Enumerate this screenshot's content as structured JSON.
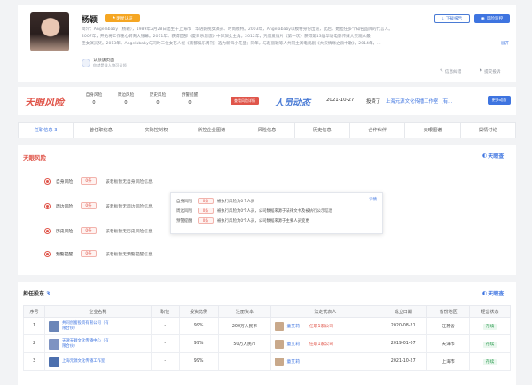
{
  "profile": {
    "name": "杨颖",
    "badge": "明星认证",
    "bio_line1": "简介：Angelababy（杨颖），1989年2月28日出生于上海市，华语影视女演员、时尚模特。2003年，Angelababy以模特身份出道，此后，她担任多个知名品牌的代言人。",
    "bio_line2": "2007年，开始将工作重心转向大银幕。2011年，获得首部《夏日乐悠悠》中饰演女主角。2012年，凭借爱情片《第一次》获得第13届华语电影传媒大奖观众最",
    "bio_line3": "佳女演员奖。2013年，Angelababy与同时三位女艺人被《南都娱乐周刊》选为新四小花旦；同年，与赵丽颖等人共同主演电视剧《大汉情缘之云中歌》，2014年，...",
    "bio_more": "展开",
    "claim_text": "认领该页面",
    "claim_sub": "你就是该人物可认领",
    "btn_download": "下载报告",
    "btn_monitor": "风险监控",
    "link_feedback": "信息纠错",
    "link_report": "提交投诉"
  },
  "risk_bar": {
    "brand": "天眼风险",
    "stats": [
      {
        "label": "自身风险",
        "value": "0"
      },
      {
        "label": "周边风险",
        "value": "0"
      },
      {
        "label": "历史风险",
        "value": "0"
      },
      {
        "label": "预警提醒",
        "value": "0"
      }
    ],
    "btn_risk": "查看风险详情",
    "news_brand": "人员动态",
    "news_date": "2021-10-27",
    "news_text": "投资了",
    "news_company": "上海元源文化传播工作室（有...",
    "btn_more": "更多动态"
  },
  "tabs": [
    {
      "label": "任职信息",
      "count": "3"
    },
    {
      "label": "曾任职信息",
      "count": ""
    },
    {
      "label": "实际控制权",
      "count": ""
    },
    {
      "label": "所控企业图谱",
      "count": ""
    },
    {
      "label": "风险信息",
      "count": ""
    },
    {
      "label": "历史信息",
      "count": ""
    },
    {
      "label": "合作伙伴",
      "count": ""
    },
    {
      "label": "天眼图谱",
      "count": ""
    },
    {
      "label": "舆情讨论",
      "count": ""
    }
  ],
  "risk_section": {
    "title": "天眼风险",
    "logo": "天眼查",
    "rows": [
      {
        "label": "自身风险",
        "count": "0条",
        "desc": "该老板暂无自身风险信息"
      },
      {
        "label": "周边风险",
        "count": "0条",
        "desc": "该老板暂无周边风险信息"
      },
      {
        "label": "历史风险",
        "count": "0条",
        "desc": "该老板暂无历史风险信息"
      },
      {
        "label": "预警提醒",
        "count": "0条",
        "desc": "该老板暂无预警提醒信息"
      }
    ],
    "popup": {
      "rows": [
        {
          "label": "自身风险",
          "tag": "0条",
          "text": "被执行风险为0个人员"
        },
        {
          "label": "周边风险",
          "tag": "0条",
          "text": "被执行风险为0个人员，公司数据来源于法律文书及被执行公示信息"
        },
        {
          "label": "预警提醒",
          "tag": "0条",
          "text": "被执行风险为0个人员，公司数据来源于主要人员变更"
        }
      ],
      "link": "详情"
    }
  },
  "holdings": {
    "title": "担任股东",
    "count": "3",
    "logo": "天眼查",
    "headers": [
      "序号",
      "企业名称",
      "职位",
      "投资比例",
      "注册资本",
      "法定代表人",
      "成立日期",
      "省份地区",
      "经营状态"
    ],
    "rows": [
      {
        "no": "1",
        "name_a": "共同创富投资有限公司（有",
        "name_b": "限合伙）",
        "role": "-",
        "ratio": "99%",
        "capital": "200万人民币",
        "rep": "童艾莉",
        "rep_more": "任职1家公司",
        "date": "2020-08-21",
        "region": "江苏省",
        "status": "存续"
      },
      {
        "no": "2",
        "name_a": "天津天颖文化传播中心（有",
        "name_b": "限合伙）",
        "role": "-",
        "ratio": "99%",
        "capital": "50万人民币",
        "rep": "童艾莉",
        "rep_more": "任职1家公司",
        "date": "2019-01-07",
        "region": "天津市",
        "status": "存续"
      },
      {
        "no": "3",
        "name_a": "上海元源文化传播工作室",
        "name_b": "",
        "role": "-",
        "ratio": "99%",
        "capital": "",
        "rep": "童艾莉",
        "rep_more": "",
        "date": "2021-10-27",
        "region": "上海市",
        "status": "存续"
      }
    ]
  },
  "colors": {
    "accent": "#3e74e0",
    "risk_red": "#e0554a",
    "news_blue": "#4a7bd5"
  }
}
